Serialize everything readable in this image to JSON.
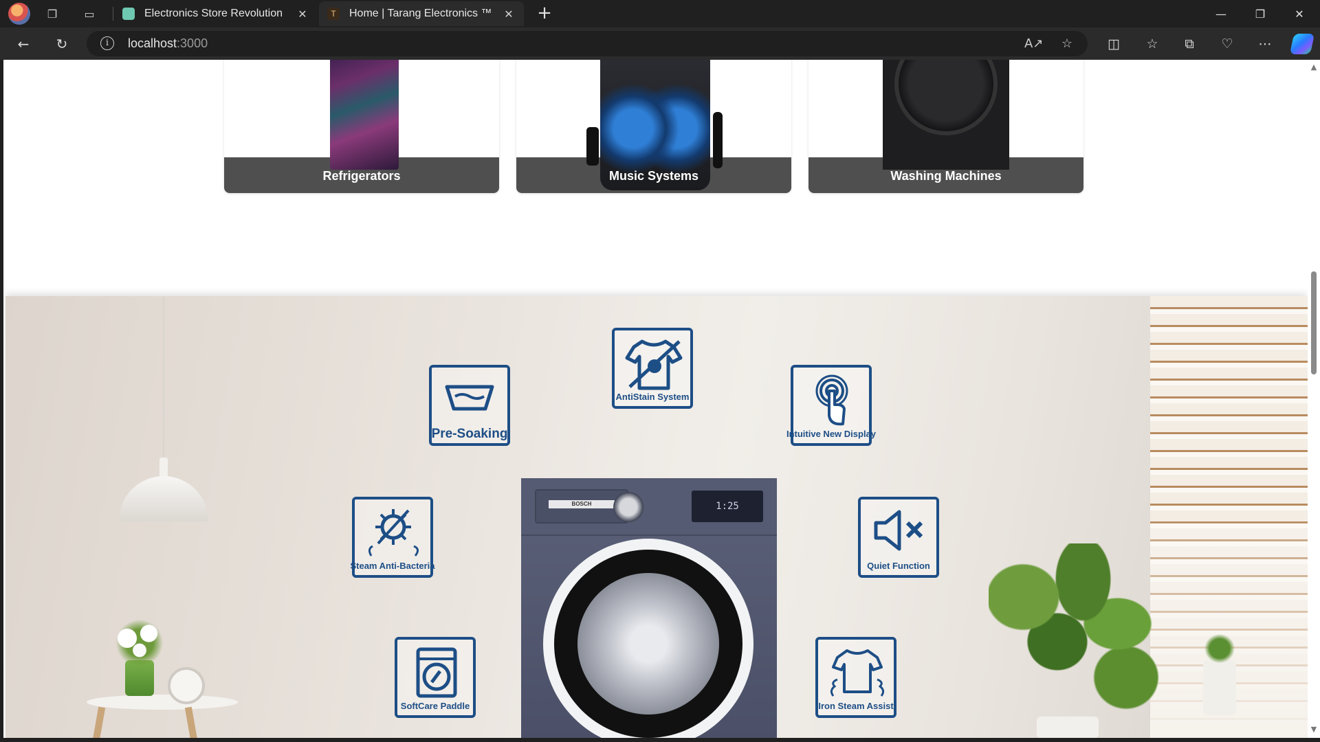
{
  "browser": {
    "tabs": [
      {
        "title": "Electronics Store Revolution",
        "active": false
      },
      {
        "title": "Home | Tarang Electronics ™",
        "active": true
      }
    ],
    "url_host": "localhost",
    "url_port": ":3000"
  },
  "categories": [
    {
      "label": "Refrigerators"
    },
    {
      "label": "Music Systems"
    },
    {
      "label": "Washing Machines"
    }
  ],
  "banner": {
    "brand_badge": "BOSCH",
    "display_readout": "1:25",
    "features": [
      {
        "label": "Pre-Soaking",
        "icon": "basin-icon"
      },
      {
        "label": "AntiStain System",
        "icon": "tshirt-stain-icon"
      },
      {
        "label": "Intuitive New Display",
        "icon": "touch-finger-icon"
      },
      {
        "label": "Steam Anti-Bacteria",
        "icon": "bacteria-steam-icon"
      },
      {
        "label": "Quiet Function",
        "icon": "mute-speaker-icon"
      },
      {
        "label": "SoftCare Paddle",
        "icon": "washer-drum-icon"
      },
      {
        "label": "Iron Steam Assist",
        "icon": "shirt-steam-icon"
      }
    ]
  },
  "colors": {
    "feature_blue": "#1d4e86",
    "card_strip": "#4f4f4f"
  }
}
